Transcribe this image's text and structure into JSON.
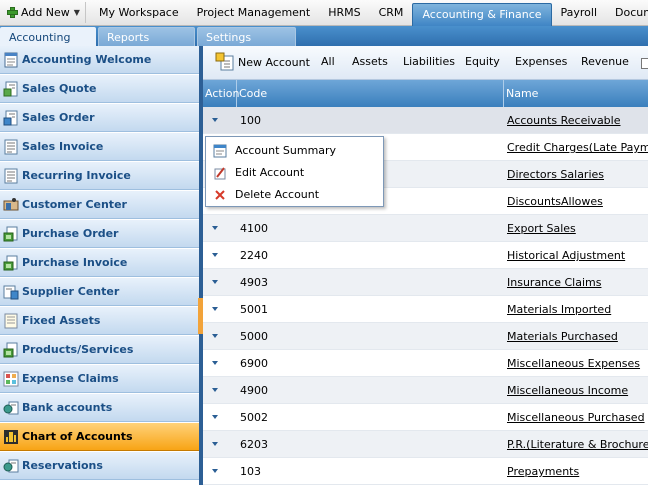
{
  "topbar": {
    "add_new_label": "Add New",
    "items": [
      "My Workspace",
      "Project Management",
      "HRMS",
      "CRM",
      "Accounting & Finance",
      "Payroll",
      "Documents"
    ],
    "active_item": "Accounting & Finance"
  },
  "subtabs": [
    "Accounting",
    "Reports",
    "Settings"
  ],
  "active_subtab": "Accounting",
  "sidebar": {
    "items": [
      {
        "label": "Accounting Welcome",
        "icon": "ledger-icon"
      },
      {
        "label": "Sales Quote",
        "icon": "quote-document-icon"
      },
      {
        "label": "Sales Order",
        "icon": "order-document-icon"
      },
      {
        "label": "Sales Invoice",
        "icon": "invoice-document-icon"
      },
      {
        "label": "Recurring Invoice",
        "icon": "recurring-invoice-icon"
      },
      {
        "label": "Customer Center",
        "icon": "customer-icon"
      },
      {
        "label": "Purchase Order",
        "icon": "purchase-order-icon"
      },
      {
        "label": "Purchase Invoice",
        "icon": "purchase-invoice-icon"
      },
      {
        "label": "Supplier Center",
        "icon": "supplier-icon"
      },
      {
        "label": "Fixed Assets",
        "icon": "fixed-assets-icon"
      },
      {
        "label": "Products/Services",
        "icon": "products-icon"
      },
      {
        "label": "Expense Claims",
        "icon": "expense-icon"
      },
      {
        "label": "Bank accounts",
        "icon": "bank-icon"
      },
      {
        "label": "Chart of Accounts",
        "icon": "chart-of-accounts-icon"
      },
      {
        "label": "Reservations",
        "icon": "reservations-icon"
      }
    ],
    "active_item": "Chart of Accounts"
  },
  "toolbar": {
    "new_account_label": "New Account",
    "filters": [
      "All",
      "Assets",
      "Liabilities",
      "Equity",
      "Expenses",
      "Revenue"
    ]
  },
  "grid": {
    "columns": [
      "Action",
      "Code",
      "Name"
    ],
    "rows": [
      {
        "code": "100",
        "name": "Accounts Receivable"
      },
      {
        "code": "",
        "name": "Credit Charges(Late Payment"
      },
      {
        "code": "",
        "name": "Directors Salaries"
      },
      {
        "code": "",
        "name": "DiscountsAllowes"
      },
      {
        "code": "4100",
        "name": "Export Sales"
      },
      {
        "code": "2240",
        "name": "Historical Adjustment"
      },
      {
        "code": "4903",
        "name": "Insurance Claims"
      },
      {
        "code": "5001",
        "name": "Materials Imported"
      },
      {
        "code": "5000",
        "name": "Materials Purchased"
      },
      {
        "code": "6900",
        "name": "Miscellaneous Expenses"
      },
      {
        "code": "4900",
        "name": "Miscellaneous Income"
      },
      {
        "code": "5002",
        "name": "Miscellaneous Purchased"
      },
      {
        "code": "6203",
        "name": "P.R.(Literature & Brochures"
      },
      {
        "code": "103",
        "name": "Prepayments"
      }
    ]
  },
  "context_menu": {
    "items": [
      {
        "label": "Account Summary",
        "icon": "summary-icon"
      },
      {
        "label": "Edit Account",
        "icon": "edit-icon"
      },
      {
        "label": "Delete Account",
        "icon": "delete-icon"
      }
    ]
  },
  "colors": {
    "header_blue": "#3a7fbd",
    "active_orange": "#f8a415",
    "sidebar_text": "#1b4f86"
  }
}
